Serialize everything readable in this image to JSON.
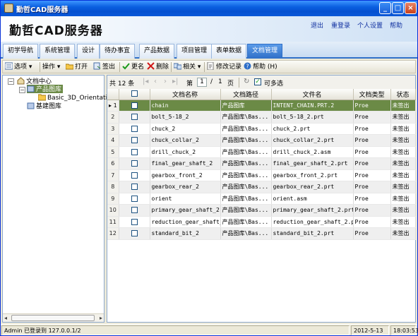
{
  "window": {
    "title": "勤哲CAD服务器"
  },
  "banner": {
    "logo": "勤哲CAD服务器",
    "links": [
      "退出",
      "重登录",
      "个人设置",
      "帮助"
    ]
  },
  "tabs": [
    "初学导航",
    "系统管理",
    "设计",
    "待办事宜",
    "产品数据",
    "项目管理",
    "表单数据",
    "文档管理"
  ],
  "toolbar": {
    "options": "选项",
    "operate": "操作",
    "open": "打开",
    "checkout": "签出",
    "rename": "更名",
    "delete": "删除",
    "related": "相关",
    "modify_log": "修改记录",
    "help": "帮助",
    "help_key": "(H)"
  },
  "tree": {
    "root": "文档中心",
    "child": "产品图库",
    "grandchild": "Basic_3D_Orientatio",
    "sibling": "基建图库"
  },
  "pager": {
    "total_prefix": "共",
    "total": "12",
    "items_unit": "条",
    "page_prefix": "第",
    "page": "1",
    "sep": "/",
    "pages": "1",
    "page_unit": "页",
    "multi": "可多选"
  },
  "table": {
    "headers": [
      "文档名称",
      "文档路径",
      "文件名",
      "文档类型",
      "状态"
    ],
    "rows": [
      {
        "n": "1",
        "name": "chain",
        "path": "产品图库",
        "file": "INTENT_CHAIN.PRT.2",
        "type": "Proe",
        "status": "未签出"
      },
      {
        "n": "2",
        "name": "bolt_5-18_2",
        "path": "产品图库\\Bas...",
        "file": "bolt_5-18_2.prt",
        "type": "Proe",
        "status": "未签出"
      },
      {
        "n": "3",
        "name": "chuck_2",
        "path": "产品图库\\Bas...",
        "file": "chuck_2.prt",
        "type": "Proe",
        "status": "未签出"
      },
      {
        "n": "4",
        "name": "chuck_collar_2",
        "path": "产品图库\\Bas...",
        "file": "chuck_collar_2.prt",
        "type": "Proe",
        "status": "未签出"
      },
      {
        "n": "5",
        "name": "drill_chuck_2",
        "path": "产品图库\\Bas...",
        "file": "drill_chuck_2.asm",
        "type": "Proe",
        "status": "未签出"
      },
      {
        "n": "6",
        "name": "final_gear_shaft_2",
        "path": "产品图库\\Bas...",
        "file": "final_gear_shaft_2.prt",
        "type": "Proe",
        "status": "未签出"
      },
      {
        "n": "7",
        "name": "gearbox_front_2",
        "path": "产品图库\\Bas...",
        "file": "gearbox_front_2.prt",
        "type": "Proe",
        "status": "未签出"
      },
      {
        "n": "8",
        "name": "gearbox_rear_2",
        "path": "产品图库\\Bas...",
        "file": "gearbox_rear_2.prt",
        "type": "Proe",
        "status": "未签出"
      },
      {
        "n": "9",
        "name": "orient",
        "path": "产品图库\\Bas...",
        "file": "orient.asm",
        "type": "Proe",
        "status": "未签出"
      },
      {
        "n": "10",
        "name": "primary_gear_shaft_2",
        "path": "产品图库\\Bas...",
        "file": "primary_gear_shaft_2.prt",
        "type": "Proe",
        "status": "未签出"
      },
      {
        "n": "11",
        "name": "reduction_gear_shaft_2",
        "path": "产品图库\\Bas...",
        "file": "reduction_gear_shaft_2.prt",
        "type": "Proe",
        "status": "未签出"
      },
      {
        "n": "12",
        "name": "standard_bit_2",
        "path": "产品图库\\Bas...",
        "file": "standard_bit_2.prt",
        "type": "Proe",
        "status": "未签出"
      }
    ]
  },
  "status": {
    "user": "Admin 已登录到 127.0.0.1/2",
    "date": "2012-5-13",
    "time": "18:03:53"
  },
  "colors": {
    "title_bar": "#0a5fe0",
    "active_tab": "#2f6fc8",
    "selected_row": "#6b8a46"
  }
}
